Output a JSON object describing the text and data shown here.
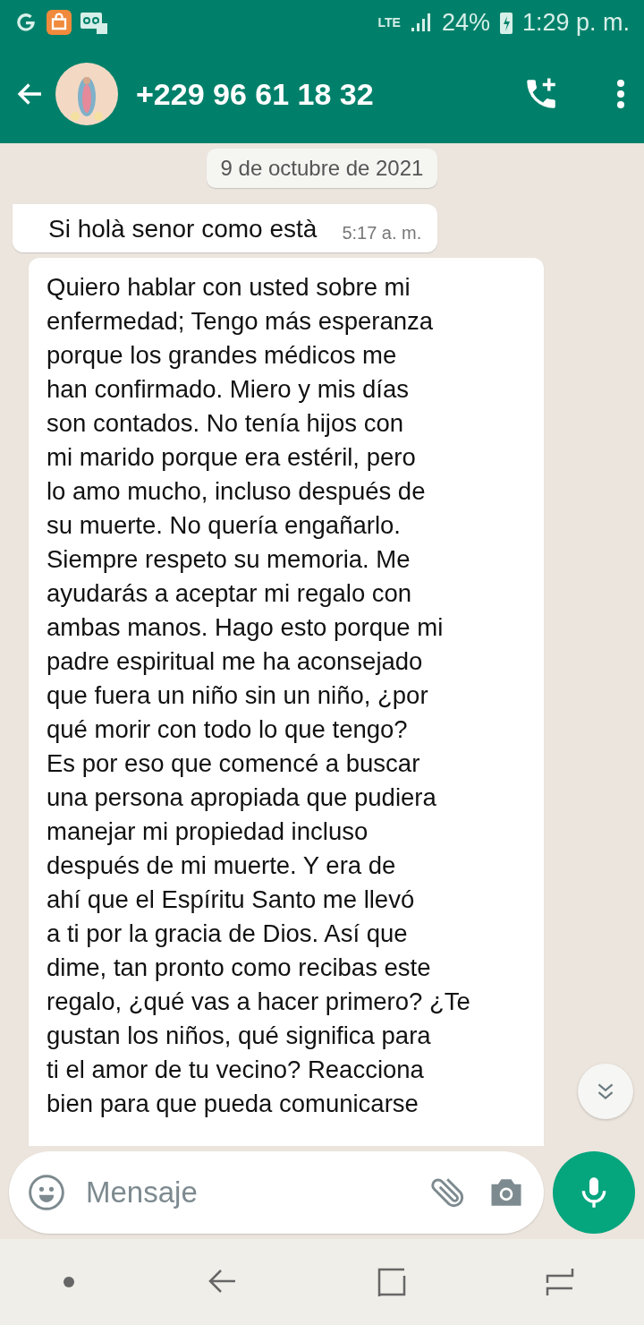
{
  "status_bar": {
    "time": "1:29 p. m.",
    "battery": "24%",
    "network": "LTE"
  },
  "header": {
    "title": "+229 96 61 18 32"
  },
  "date_chip": "9 de octubre de 2021",
  "messages": [
    {
      "kind": "short",
      "text": "Si holà senor como està",
      "time": "5:17 a. m."
    },
    {
      "kind": "long",
      "lines": [
        "Quiero hablar con usted sobre mi",
        "enfermedad; Tengo más esperanza",
        "porque los grandes médicos me",
        "han confirmado. Miero y mis días",
        "son contados. No tenía hijos con",
        "mi marido porque era estéril, pero",
        "lo amo mucho, incluso después de",
        "su muerte. No quería engañarlo.",
        "Siempre respeto su memoria. Me",
        "ayudarás a aceptar mi regalo con",
        "ambas manos. Hago esto porque mi",
        "padre espiritual me ha aconsejado",
        "que fuera un niño sin un niño, ¿por",
        "qué morir con todo lo que tengo?",
        "Es por eso que comencé a buscar",
        "una persona apropiada que pudiera",
        "manejar mi propiedad incluso",
        "después de mi muerte. Y era de",
        "ahí que el Espíritu Santo me llevó",
        "a ti por la gracia de Dios. Así que",
        "dime, tan pronto como recibas este",
        "regalo, ¿qué vas a hacer primero? ¿Te",
        "gustan los niños, qué significa para",
        "ti el amor de tu vecino? Reacciona",
        "bien para que pueda comunicarse"
      ]
    }
  ],
  "composer": {
    "placeholder": "Mensaje"
  }
}
